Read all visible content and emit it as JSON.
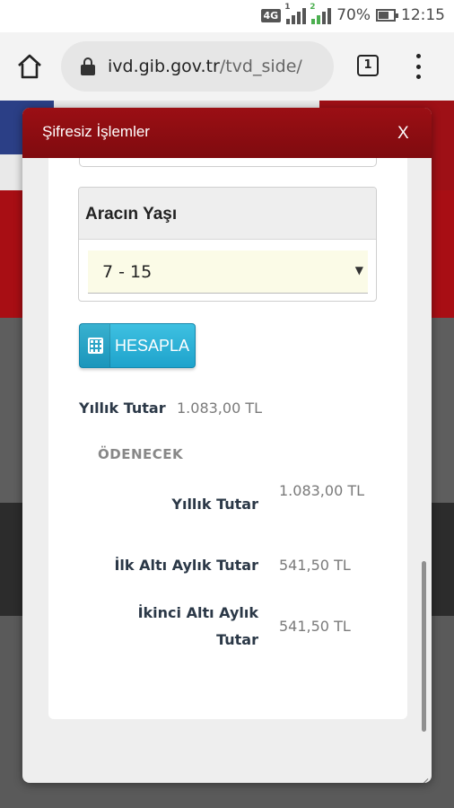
{
  "status_bar": {
    "network": "4G",
    "sim1_label": "1",
    "sim2_label": "2",
    "battery": "70%",
    "battery_level": 0.7,
    "time": "12:15"
  },
  "browser": {
    "url_domain": "ivd.gib.gov.tr",
    "url_path": "/tvd_side/",
    "tab_count": "1"
  },
  "modal": {
    "title": "Şifresiz İşlemler",
    "close_label": "X",
    "vehicle_age": {
      "label": "Aracın Yaşı",
      "selected": "7 - 15"
    },
    "calculate_button": "HESAPLA",
    "result": {
      "label": "Yıllık Tutar",
      "value": "1.083,00 TL"
    },
    "payable": {
      "title": "ÖDENECEK",
      "rows": [
        {
          "label": "Yıllık Tutar",
          "value": "1.083,00 TL"
        },
        {
          "label": "İlk Altı Aylık Tutar",
          "value": "541,50 TL"
        },
        {
          "label": "İkinci Altı Aylık Tutar",
          "value": "541,50 TL"
        }
      ]
    }
  },
  "colors": {
    "header_red": "#9b0f14",
    "button_blue": "#2bb3da",
    "label_navy": "#2b3847",
    "value_gray": "#7a7a7a"
  }
}
